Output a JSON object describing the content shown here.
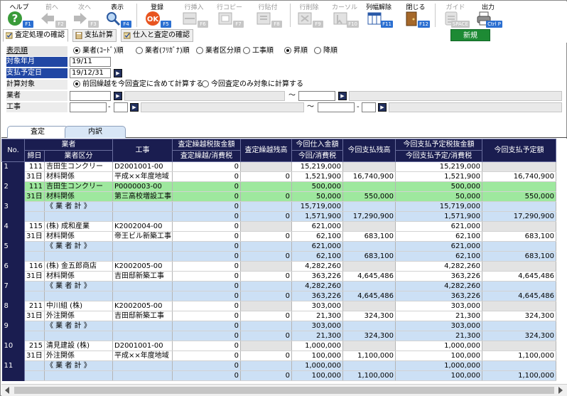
{
  "toolbar": {
    "items": [
      {
        "label": "ヘルプ",
        "key": "F1",
        "icon": "help-icon",
        "enabled": true
      },
      {
        "label": "前へ",
        "key": "F2",
        "icon": "arrow-left-icon",
        "enabled": false
      },
      {
        "label": "次へ",
        "key": "F3",
        "icon": "arrow-right-icon",
        "enabled": false
      },
      {
        "label": "表示",
        "key": "F4",
        "icon": "search-icon",
        "enabled": true
      },
      {
        "label": "登録",
        "key": "F5",
        "icon": "ok-icon",
        "enabled": true
      },
      {
        "label": "行挿入",
        "key": "F6",
        "icon": "insert-row-icon",
        "enabled": false
      },
      {
        "label": "行コピー",
        "key": "F7",
        "icon": "copy-row-icon",
        "enabled": false
      },
      {
        "label": "行貼付",
        "key": "F8",
        "icon": "paste-row-icon",
        "enabled": false
      },
      {
        "label": "行削除",
        "key": "F9",
        "icon": "delete-row-icon",
        "enabled": false
      },
      {
        "label": "カーソル",
        "key": "F10",
        "icon": "cursor-icon",
        "enabled": false
      },
      {
        "label": "列幅解除",
        "key": "F11",
        "icon": "column-width-icon",
        "enabled": true
      },
      {
        "label": "閉じる",
        "key": "F12",
        "icon": "door-icon",
        "enabled": true
      },
      {
        "label": "ガイド",
        "key": "SPACE",
        "icon": "guide-icon",
        "enabled": false
      },
      {
        "label": "出力",
        "key": "Ctrl P",
        "icon": "printer-icon",
        "enabled": true
      }
    ]
  },
  "tabs": [
    {
      "label": "査定処理の確認",
      "icon": "check-icon"
    },
    {
      "label": "支払計算",
      "icon": "calc-icon"
    },
    {
      "label": "仕入と査定の確認",
      "icon": "check-icon"
    }
  ],
  "new_button": "新規",
  "form": {
    "display_order": {
      "label": "表示順",
      "options": [
        "業者(ｺｰﾄﾞ)順",
        "業者(ﾌﾘｶﾞﾅ)順",
        "業者区分順",
        "工事順"
      ],
      "selected": 0,
      "sort_options": [
        "昇順",
        "降順"
      ],
      "sort_selected": 0
    },
    "target_month": {
      "label": "対象年月",
      "value": "19/11"
    },
    "payment_date": {
      "label": "支払予定日",
      "value": "19/12/31"
    },
    "calc_target": {
      "label": "計算対象",
      "options": [
        "前回繰越を今回査定に含めて計算する",
        "今回査定のみ対象に計算する"
      ],
      "selected": 0
    },
    "vendor": {
      "label": "業者",
      "tilde": "～"
    },
    "project": {
      "label": "工事",
      "tilde": "～",
      "dash": "-"
    }
  },
  "grid_tabs": [
    "査定",
    "内訳"
  ],
  "columns": {
    "no": "No.",
    "vendor": "業者",
    "day": "締日",
    "category": "業者区分",
    "project": "工事",
    "prev_amount": "査定繰越税抜金額",
    "prev_tax": "査定繰越/消費税",
    "prev_balance": "査定繰越残高",
    "curr_purchase": "今回仕入金額",
    "curr_tax": "今回/消費税",
    "curr_balance": "今回支払残高",
    "plan_amount": "今回支払予定税抜金額",
    "plan_tax": "今回支払予定/消費税",
    "plan_total": "今回支払予定額"
  },
  "rows": [
    {
      "no": "1",
      "style": "w",
      "a": {
        "code": "111",
        "name": "吉田生コンクリー",
        "project": "D2001001-00",
        "prev": "0",
        "prev_bal": "",
        "purchase": "15,219,000",
        "balance": "",
        "plan": "15,219,000",
        "plan_total": ""
      },
      "b": {
        "day": "31日",
        "cat": "材料関係",
        "project": "平成××年度地域",
        "prev": "0",
        "prev_bal": "0",
        "purchase": "1,521,900",
        "balance": "16,740,900",
        "plan": "1,521,900",
        "plan_total": "16,740,900"
      }
    },
    {
      "no": "2",
      "style": "gn",
      "a": {
        "code": "111",
        "name": "吉田生コンクリー",
        "project": "P0000003-00",
        "prev": "0",
        "prev_bal": "",
        "purchase": "500,000",
        "balance": "",
        "plan": "500,000",
        "plan_total": ""
      },
      "b": {
        "day": "31日",
        "cat": "材料関係",
        "project": "第三高校増設工事",
        "prev": "0",
        "prev_bal": "0",
        "purchase": "50,000",
        "balance": "550,000",
        "plan": "50,000",
        "plan_total": "550,000"
      }
    },
    {
      "no": "3",
      "style": "b",
      "a": {
        "code": "",
        "name": "《 業 者 計 》",
        "project": "",
        "prev": "0",
        "prev_bal": "",
        "purchase": "15,719,000",
        "balance": "",
        "plan": "15,719,000",
        "plan_total": ""
      },
      "b": {
        "day": "",
        "cat": "",
        "project": "",
        "prev": "0",
        "prev_bal": "0",
        "purchase": "1,571,900",
        "balance": "17,290,900",
        "plan": "1,571,900",
        "plan_total": "17,290,900"
      }
    },
    {
      "no": "4",
      "style": "w",
      "a": {
        "code": "115",
        "name": "(株) 成和産業",
        "project": "K2002004-00",
        "prev": "0",
        "prev_bal": "",
        "purchase": "621,000",
        "balance": "",
        "plan": "621,000",
        "plan_total": ""
      },
      "b": {
        "day": "31日",
        "cat": "材料関係",
        "project": "帝王ビル新築工事",
        "prev": "0",
        "prev_bal": "0",
        "purchase": "62,100",
        "balance": "683,100",
        "plan": "62,100",
        "plan_total": "683,100"
      }
    },
    {
      "no": "5",
      "style": "b",
      "a": {
        "code": "",
        "name": "《 業 者 計 》",
        "project": "",
        "prev": "0",
        "prev_bal": "",
        "purchase": "621,000",
        "balance": "",
        "plan": "621,000",
        "plan_total": ""
      },
      "b": {
        "day": "",
        "cat": "",
        "project": "",
        "prev": "0",
        "prev_bal": "0",
        "purchase": "62,100",
        "balance": "683,100",
        "plan": "62,100",
        "plan_total": "683,100"
      }
    },
    {
      "no": "6",
      "style": "w",
      "a": {
        "code": "116",
        "name": "(株) 金五郎商店",
        "project": "K2002005-00",
        "prev": "0",
        "prev_bal": "",
        "purchase": "4,282,260",
        "balance": "",
        "plan": "4,282,260",
        "plan_total": ""
      },
      "b": {
        "day": "31日",
        "cat": "材料関係",
        "project": "吉田邸新築工事",
        "prev": "0",
        "prev_bal": "0",
        "purchase": "363,226",
        "balance": "4,645,486",
        "plan": "363,226",
        "plan_total": "4,645,486"
      }
    },
    {
      "no": "7",
      "style": "b",
      "a": {
        "code": "",
        "name": "《 業 者 計 》",
        "project": "",
        "prev": "0",
        "prev_bal": "",
        "purchase": "4,282,260",
        "balance": "",
        "plan": "4,282,260",
        "plan_total": ""
      },
      "b": {
        "day": "",
        "cat": "",
        "project": "",
        "prev": "0",
        "prev_bal": "0",
        "purchase": "363,226",
        "balance": "4,645,486",
        "plan": "363,226",
        "plan_total": "4,645,486"
      }
    },
    {
      "no": "8",
      "style": "w",
      "a": {
        "code": "211",
        "name": "中川組 (株)",
        "project": "K2002005-00",
        "prev": "0",
        "prev_bal": "",
        "purchase": "303,000",
        "balance": "",
        "plan": "303,000",
        "plan_total": ""
      },
      "b": {
        "day": "31日",
        "cat": "外注関係",
        "project": "吉田邸新築工事",
        "prev": "0",
        "prev_bal": "0",
        "purchase": "21,300",
        "balance": "324,300",
        "plan": "21,300",
        "plan_total": "324,300"
      }
    },
    {
      "no": "9",
      "style": "b",
      "a": {
        "code": "",
        "name": "《 業 者 計 》",
        "project": "",
        "prev": "0",
        "prev_bal": "",
        "purchase": "303,000",
        "balance": "",
        "plan": "303,000",
        "plan_total": ""
      },
      "b": {
        "day": "",
        "cat": "",
        "project": "",
        "prev": "0",
        "prev_bal": "0",
        "purchase": "21,300",
        "balance": "324,300",
        "plan": "21,300",
        "plan_total": "324,300"
      }
    },
    {
      "no": "10",
      "style": "w",
      "a": {
        "code": "215",
        "name": "清見建設 (株)",
        "project": "D2001001-00",
        "prev": "0",
        "prev_bal": "",
        "purchase": "1,000,000",
        "balance": "",
        "plan": "1,000,000",
        "plan_total": ""
      },
      "b": {
        "day": "31日",
        "cat": "外注関係",
        "project": "平成××年度地域",
        "prev": "0",
        "prev_bal": "0",
        "purchase": "100,000",
        "balance": "1,100,000",
        "plan": "100,000",
        "plan_total": "1,100,000"
      }
    },
    {
      "no": "11",
      "style": "b",
      "a": {
        "code": "",
        "name": "《 業 者 計 》",
        "project": "",
        "prev": "0",
        "prev_bal": "",
        "purchase": "1,000,000",
        "balance": "",
        "plan": "1,000,000",
        "plan_total": ""
      },
      "b": {
        "day": "",
        "cat": "",
        "project": "",
        "prev": "0",
        "prev_bal": "0",
        "purchase": "100,000",
        "balance": "1,100,000",
        "plan": "100,000",
        "plan_total": "1,100,000"
      }
    }
  ]
}
